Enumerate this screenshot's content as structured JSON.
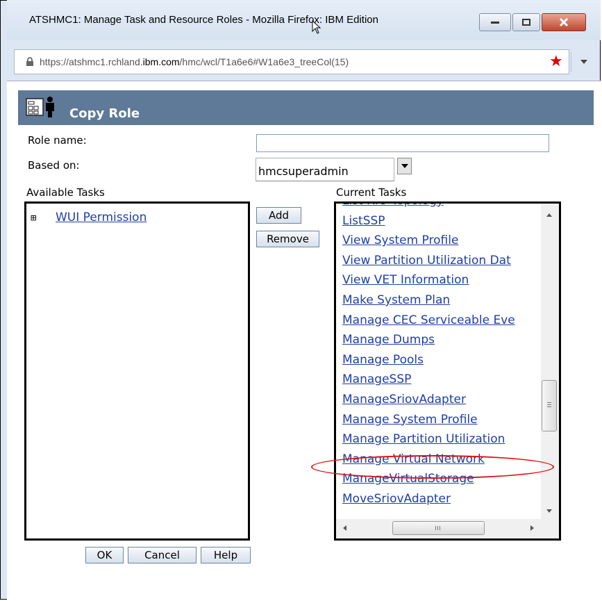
{
  "window": {
    "title": "ATSHMC1: Manage Task and Resource Roles - Mozilla Firefox: IBM Edition"
  },
  "browser": {
    "url_prefix": "https://atshmc1.rchland.",
    "url_domain": "ibm.com",
    "url_path": "/hmc/wcl/T1a6e6#W1a6e3_treeCol(15)"
  },
  "dialog": {
    "title": "Copy Role",
    "role_name_label": "Role name:",
    "role_name_value": "",
    "based_on_label": "Based on:",
    "based_on_value": "hmcsuperadmin",
    "available_tasks_label": "Available Tasks",
    "current_tasks_label": "Current Tasks",
    "available_tree_toggle": "⊞",
    "available_tree": [
      "WUI Permission"
    ],
    "current_tasks": [
      "List RIO Topology",
      "ListSSP",
      "View System Profile",
      "View Partition Utilization Dat",
      "View VET Information",
      "Make System Plan",
      "Manage CEC Serviceable Eve",
      "Manage Dumps",
      "Manage Pools",
      "ManageSSP",
      "ManageSriovAdapter",
      "Manage System Profile",
      "Manage Partition Utilization",
      "Manage Virtual Network",
      "ManageVirtualStorage",
      "MoveSriovAdapter"
    ],
    "highlighted_task": "Manage Virtual Network",
    "add_label": "Add",
    "remove_label": "Remove",
    "ok_label": "OK",
    "cancel_label": "Cancel",
    "help_label": "Help"
  },
  "colors": {
    "header_bg": "#5f7998",
    "link": "#1f3ea6",
    "highlight_ellipse": "#e01010",
    "bookmark_star": "#e00000"
  }
}
